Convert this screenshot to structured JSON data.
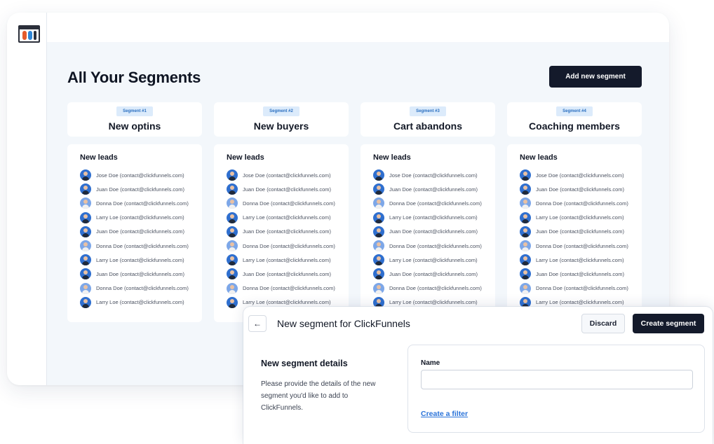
{
  "app": {
    "logo_icon": "clickfunnels-logo-icon"
  },
  "page": {
    "title": "All Your Segments",
    "add_button_label": "Add new segment"
  },
  "segments": [
    {
      "badge": "Segment #1",
      "name": "New optins",
      "list_title": "New leads",
      "leads": [
        "Jose Doe (contact@clickfunnels.com)",
        "Juan Doe (contact@clickfunnels.com)",
        "Donna Doe (contact@clickfunnels.com)",
        "Larry Loe (contact@clickfunnels.com)",
        "Juan Doe (contact@clickfunnels.com)",
        "Donna Doe (contact@clickfunnels.com)",
        "Larry Loe (contact@clickfunnels.com)",
        "Juan Doe (contact@clickfunnels.com)",
        "Donna Doe (contact@clickfunnels.com)",
        "Larry Loe (contact@clickfunnels.com)"
      ]
    },
    {
      "badge": "Segment #2",
      "name": "New buyers",
      "list_title": "New leads",
      "leads": [
        "Jose Doe (contact@clickfunnels.com)",
        "Juan Doe (contact@clickfunnels.com)",
        "Donna Doe (contact@clickfunnels.com)",
        "Larry Loe (contact@clickfunnels.com)",
        "Juan Doe (contact@clickfunnels.com)",
        "Donna Doe (contact@clickfunnels.com)",
        "Larry Loe (contact@clickfunnels.com)",
        "Juan Doe (contact@clickfunnels.com)",
        "Donna Doe (contact@clickfunnels.com)",
        "Larry Loe (contact@clickfunnels.com)"
      ]
    },
    {
      "badge": "Segment #3",
      "name": "Cart abandons",
      "list_title": "New leads",
      "leads": [
        "Jose Doe (contact@clickfunnels.com)",
        "Juan Doe (contact@clickfunnels.com)",
        "Donna Doe (contact@clickfunnels.com)",
        "Larry Loe (contact@clickfunnels.com)",
        "Juan Doe (contact@clickfunnels.com)",
        "Donna Doe (contact@clickfunnels.com)",
        "Larry Loe (contact@clickfunnels.com)",
        "Juan Doe (contact@clickfunnels.com)",
        "Donna Doe (contact@clickfunnels.com)",
        "Larry Loe (contact@clickfunnels.com)"
      ]
    },
    {
      "badge": "Segment #4",
      "name": "Coaching members",
      "list_title": "New leads",
      "leads": [
        "Jose Doe (contact@clickfunnels.com)",
        "Juan Doe (contact@clickfunnels.com)",
        "Donna Doe (contact@clickfunnels.com)",
        "Larry Loe (contact@clickfunnels.com)",
        "Juan Doe (contact@clickfunnels.com)",
        "Donna Doe (contact@clickfunnels.com)",
        "Larry Loe (contact@clickfunnels.com)",
        "Juan Doe (contact@clickfunnels.com)",
        "Donna Doe (contact@clickfunnels.com)",
        "Larry Loe (contact@clickfunnels.com)"
      ]
    }
  ],
  "modal": {
    "back_icon": "arrow-left-icon",
    "title": "New segment for ClickFunnels",
    "discard_label": "Discard",
    "create_label": "Create segment",
    "details_title": "New segment details",
    "details_description": "Please provide the details of the new segment you'd like to add to ClickFunnels.",
    "name_label": "Name",
    "name_value": "",
    "filter_link": "Create a filter"
  },
  "colors": {
    "primary_button": "#141a2b",
    "badge_bg": "#dcebfb",
    "badge_text": "#2a6fc0",
    "link": "#2a73d9",
    "canvas": "#f3f7fb"
  }
}
